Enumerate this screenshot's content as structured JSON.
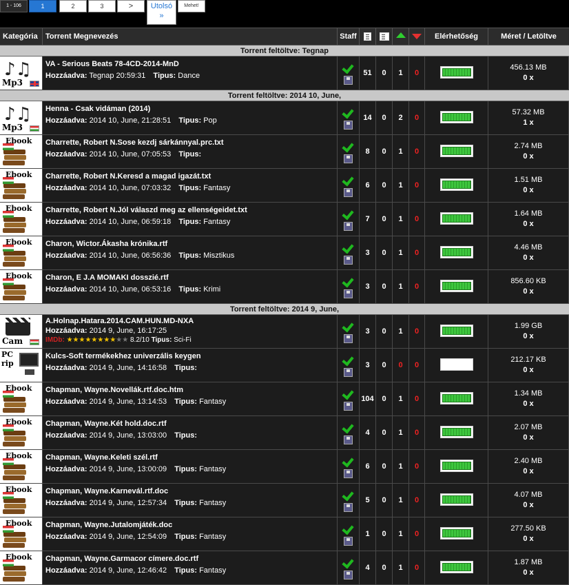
{
  "pager": {
    "range": "1 - 106",
    "pages": [
      {
        "label": "1",
        "active": true
      },
      {
        "label": "2",
        "active": false
      },
      {
        "label": "3",
        "active": false
      },
      {
        "label": ">",
        "active": false
      }
    ],
    "last_label": "Utolsó",
    "last_arrows": "»",
    "go_label": "Mehet!"
  },
  "header": {
    "category": "Kategória",
    "name": "Torrent Megnevezés",
    "staff": "Staff",
    "availability": "Elérhetőség",
    "size": "Méret / Letöltve"
  },
  "groups": [
    {
      "label": "Torrent feltöltve: Tegnap",
      "rows": [
        {
          "cat": "mp3-gb",
          "title": "VA - Serious Beats 78-4CD-2014-MnD",
          "added_label": "Hozzáadva:",
          "added": "Tegnap 20:59:31",
          "type_label": "Tipus:",
          "type": "Dance",
          "c1": "51",
          "c2": "0",
          "seed": "1",
          "leech": "0",
          "avail": 100,
          "size": "456.13 MB",
          "dl": "0 x"
        }
      ]
    },
    {
      "label": "Torrent feltöltve: 2014 10, June,",
      "rows": [
        {
          "cat": "mp3-hu",
          "title": "Henna - Csak vidáman (2014)",
          "added_label": "Hozzáadva:",
          "added": "2014 10, June, 21:28:51",
          "type_label": "Tipus:",
          "type": "Pop",
          "c1": "14",
          "c2": "0",
          "seed": "2",
          "leech": "0",
          "avail": 100,
          "size": "57.32 MB",
          "dl": "1 x"
        },
        {
          "cat": "ebook",
          "title": "Charrette, Robert N.Sose kezdj sárkánnyal.prc.txt",
          "added_label": "Hozzáadva:",
          "added": "2014 10, June, 07:05:53",
          "type_label": "Tipus:",
          "type": "",
          "c1": "8",
          "c2": "0",
          "seed": "1",
          "leech": "0",
          "avail": 100,
          "size": "2.74 MB",
          "dl": "0 x"
        },
        {
          "cat": "ebook",
          "title": "Charrette, Robert N.Keresd a magad igazát.txt",
          "added_label": "Hozzáadva:",
          "added": "2014 10, June, 07:03:32",
          "type_label": "Tipus:",
          "type": "Fantasy",
          "c1": "6",
          "c2": "0",
          "seed": "1",
          "leech": "0",
          "avail": 100,
          "size": "1.51 MB",
          "dl": "0 x"
        },
        {
          "cat": "ebook",
          "title": "Charrette, Robert N.Jól válaszd meg az ellenségeidet.txt",
          "added_label": "Hozzáadva:",
          "added": "2014 10, June, 06:59:18",
          "type_label": "Tipus:",
          "type": "Fantasy",
          "c1": "7",
          "c2": "0",
          "seed": "1",
          "leech": "0",
          "avail": 100,
          "size": "1.64 MB",
          "dl": "0 x"
        },
        {
          "cat": "ebook",
          "title": "Charon, Wictor.Ákasha krónika.rtf",
          "added_label": "Hozzáadva:",
          "added": "2014 10, June, 06:56:36",
          "type_label": "Tipus:",
          "type": "Misztikus",
          "c1": "3",
          "c2": "0",
          "seed": "1",
          "leech": "0",
          "avail": 100,
          "size": "4.46 MB",
          "dl": "0 x"
        },
        {
          "cat": "ebook",
          "title": "Charon, E J.A MOMAKI dosszié.rtf",
          "added_label": "Hozzáadva:",
          "added": "2014 10, June, 06:53:16",
          "type_label": "Tipus:",
          "type": "Krimi",
          "c1": "3",
          "c2": "0",
          "seed": "1",
          "leech": "0",
          "avail": 100,
          "size": "856.60 KB",
          "dl": "0 x"
        }
      ]
    },
    {
      "label": "Torrent feltöltve: 2014 9, June,",
      "rows": [
        {
          "cat": "cam",
          "title": "A.Holnap.Hatara.2014.CAM.HUN.MD-NXA",
          "added_label": "Hozzáadva:",
          "added": "2014 9, June, 16:17:25",
          "type_label": "Tipus:",
          "type": "Sci-Fi",
          "imdb_label": "IMDb:",
          "imdb_stars": "★★★★★★★★",
          "imdb_stars_off": "★★",
          "imdb_score": "8.2/10",
          "c1": "3",
          "c2": "0",
          "seed": "1",
          "leech": "0",
          "avail": 100,
          "size": "1.99 GB",
          "dl": "0 x"
        },
        {
          "cat": "pcrip",
          "title": "Kulcs-Soft termékekhez univerzális keygen",
          "added_label": "Hozzáadva:",
          "added": "2014 9, June, 14:16:58",
          "type_label": "Tipus:",
          "type": "",
          "c1": "3",
          "c2": "0",
          "seed": "0",
          "leech": "0",
          "avail": 0,
          "size": "212.17 KB",
          "dl": "0 x"
        },
        {
          "cat": "ebook",
          "title": "Chapman, Wayne.Novellák.rtf.doc.htm",
          "added_label": "Hozzáadva:",
          "added": "2014 9, June, 13:14:53",
          "type_label": "Tipus:",
          "type": "Fantasy",
          "c1": "104",
          "c2": "0",
          "seed": "1",
          "leech": "0",
          "avail": 100,
          "size": "1.34 MB",
          "dl": "0 x"
        },
        {
          "cat": "ebook",
          "title": "Chapman, Wayne.Két hold.doc.rtf",
          "added_label": "Hozzáadva:",
          "added": "2014 9, June, 13:03:00",
          "type_label": "Tipus:",
          "type": "",
          "c1": "4",
          "c2": "0",
          "seed": "1",
          "leech": "0",
          "avail": 100,
          "size": "2.07 MB",
          "dl": "0 x"
        },
        {
          "cat": "ebook",
          "title": "Chapman, Wayne.Keleti szél.rtf",
          "added_label": "Hozzáadva:",
          "added": "2014 9, June, 13:00:09",
          "type_label": "Tipus:",
          "type": "Fantasy",
          "c1": "6",
          "c2": "0",
          "seed": "1",
          "leech": "0",
          "avail": 100,
          "size": "2.40 MB",
          "dl": "0 x"
        },
        {
          "cat": "ebook",
          "title": "Chapman, Wayne.Karnevál.rtf.doc",
          "added_label": "Hozzáadva:",
          "added": "2014 9, June, 12:57:34",
          "type_label": "Tipus:",
          "type": "Fantasy",
          "c1": "5",
          "c2": "0",
          "seed": "1",
          "leech": "0",
          "avail": 100,
          "size": "4.07 MB",
          "dl": "0 x"
        },
        {
          "cat": "ebook",
          "title": "Chapman, Wayne.Jutalomjáték.doc",
          "added_label": "Hozzáadva:",
          "added": "2014 9, June, 12:54:09",
          "type_label": "Tipus:",
          "type": "Fantasy",
          "c1": "1",
          "c2": "0",
          "seed": "1",
          "leech": "0",
          "avail": 100,
          "size": "277.50 KB",
          "dl": "0 x"
        },
        {
          "cat": "ebook",
          "title": "Chapman, Wayne.Garmacor címere.doc.rtf",
          "added_label": "Hozzáadva:",
          "added": "2014 9, June, 12:46:42",
          "type_label": "Tipus:",
          "type": "Fantasy",
          "c1": "4",
          "c2": "0",
          "seed": "1",
          "leech": "0",
          "avail": 100,
          "size": "1.87 MB",
          "dl": "0 x"
        }
      ]
    }
  ],
  "category_labels": {
    "mp3-gb": "Mp3",
    "mp3-hu": "Mp3",
    "ebook": "Ebook",
    "cam": "Cam",
    "pcrip": "PC rip"
  },
  "colors": {
    "active_page": "#2677d3",
    "seed_arrow": "#2fcf2f",
    "leech_arrow": "#e53030",
    "group_bar": "#c8c8c8",
    "avail_fill": "#3ec63e"
  },
  "icons": {
    "staff_ok": "green-check-icon",
    "staff_dl": "floppy-disk-icon",
    "col_comments": "comments-icon",
    "col_files": "files-icon",
    "col_seed": "green-arrow-up-icon",
    "col_leech": "red-arrow-down-icon"
  }
}
